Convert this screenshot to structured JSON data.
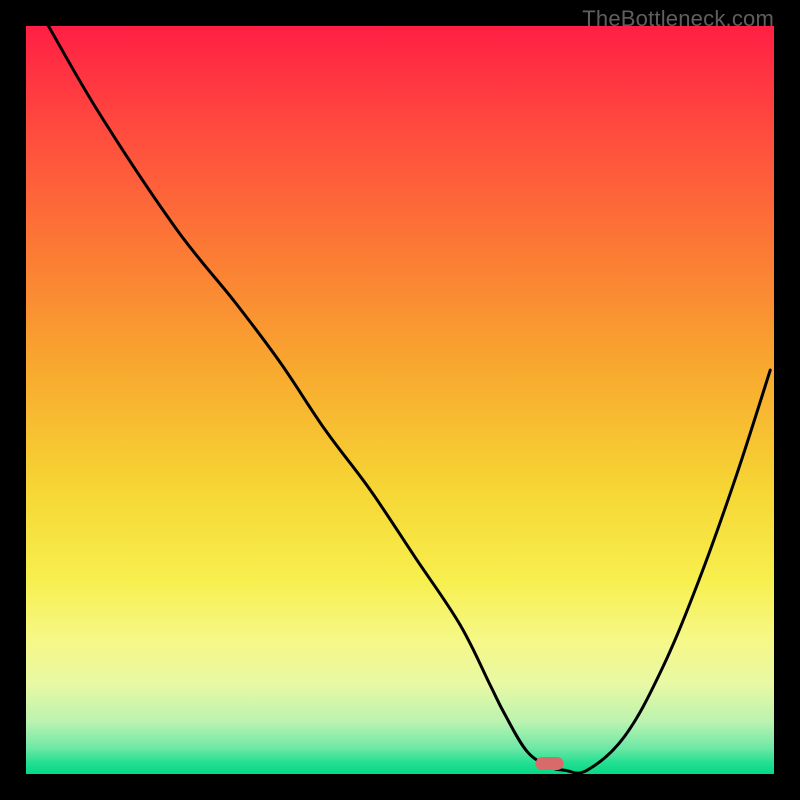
{
  "watermark": "TheBottleneck.com",
  "chart_data": {
    "type": "line",
    "title": "",
    "xlabel": "",
    "ylabel": "",
    "xlim": [
      0,
      100
    ],
    "ylim": [
      0,
      100
    ],
    "series": [
      {
        "name": "curve",
        "color": "#000000",
        "x": [
          3,
          10,
          20,
          28,
          34,
          40,
          46,
          52,
          58,
          62,
          64,
          67,
          70,
          72,
          75,
          80,
          85,
          90,
          95,
          99.5
        ],
        "y": [
          100,
          88,
          73,
          63,
          55,
          46,
          38,
          29,
          20,
          12,
          8,
          3,
          1,
          0.5,
          0.5,
          5,
          14,
          26,
          40,
          54
        ]
      }
    ],
    "marker": {
      "x": 70,
      "y": 1.4,
      "color": "#D96A6A"
    },
    "gradient_stops": [
      {
        "offset": 0.0,
        "color": "#FF1F44"
      },
      {
        "offset": 0.14,
        "color": "#FF4B3F"
      },
      {
        "offset": 0.3,
        "color": "#FC7A35"
      },
      {
        "offset": 0.46,
        "color": "#F8A92F"
      },
      {
        "offset": 0.62,
        "color": "#F6D634"
      },
      {
        "offset": 0.74,
        "color": "#F7EF4E"
      },
      {
        "offset": 0.82,
        "color": "#F6F886"
      },
      {
        "offset": 0.88,
        "color": "#E8F8A4"
      },
      {
        "offset": 0.93,
        "color": "#BBF3B0"
      },
      {
        "offset": 0.965,
        "color": "#6FE8A6"
      },
      {
        "offset": 0.985,
        "color": "#23DF92"
      },
      {
        "offset": 1.0,
        "color": "#05D984"
      }
    ]
  }
}
